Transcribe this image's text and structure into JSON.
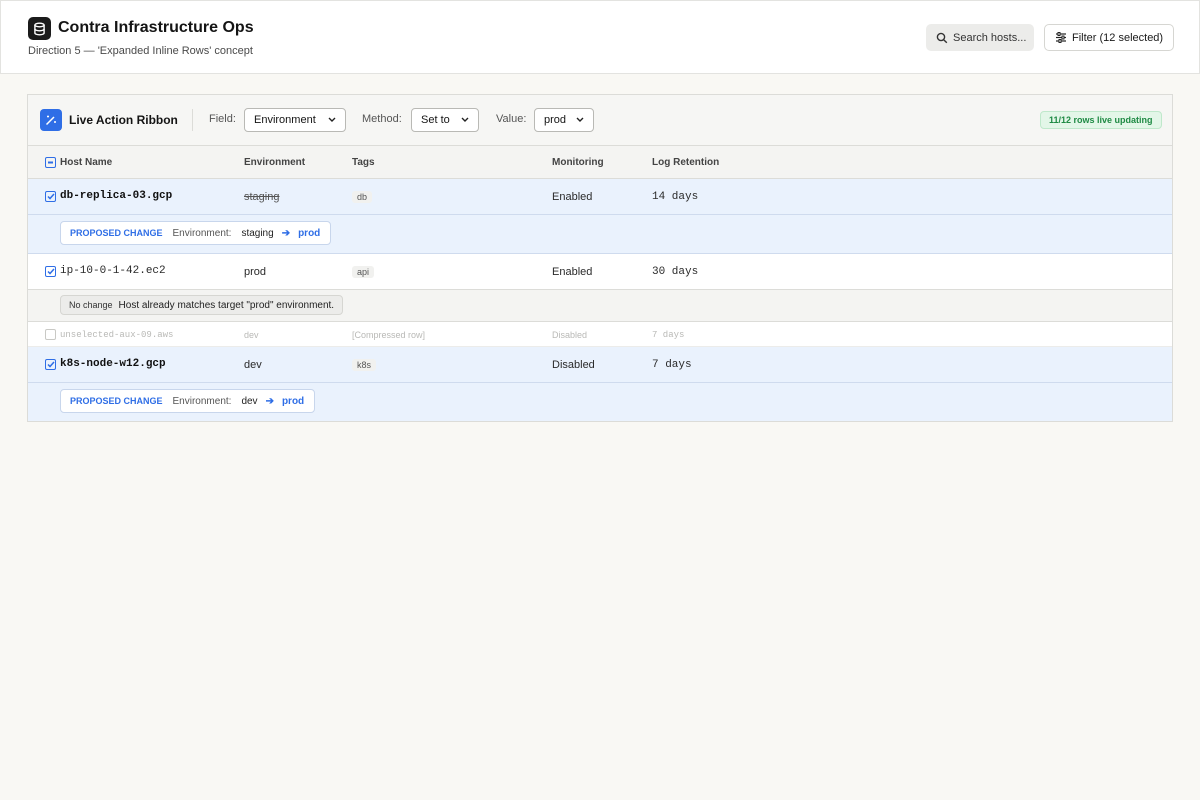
{
  "header": {
    "title": "Contra Infrastructure Ops",
    "subtitle": "Direction 5 — 'Expanded Inline Rows' concept",
    "search_placeholder": "Search hosts...",
    "filter_label": "Filter (12 selected)"
  },
  "ribbon": {
    "title": "Live Action Ribbon",
    "field_label": "Field:",
    "field_value": "Environment",
    "method_label": "Method:",
    "method_value": "Set to",
    "value_label": "Value:",
    "value_value": "prod",
    "live_status": "11/12 rows live updating"
  },
  "table": {
    "columns": [
      "Host Name",
      "Environment",
      "Tags",
      "Monitoring",
      "Log Retention"
    ],
    "rows": [
      {
        "host": "db-replica-03.gcp",
        "environment": "staging",
        "tag": "db",
        "monitoring": "Enabled",
        "retention": "14 days",
        "selected": true
      },
      {
        "host": "ip-10-0-1-42.ec2",
        "environment": "prod",
        "tag": "api",
        "monitoring": "Enabled",
        "retention": "30 days",
        "selected": true
      },
      {
        "host": "unselected-aux-09.aws",
        "environment": "dev",
        "tag": "[Compressed row]",
        "monitoring": "Disabled",
        "retention": "7 days",
        "selected": false
      },
      {
        "host": "k8s-node-w12.gcp",
        "environment": "dev",
        "tag": "k8s",
        "monitoring": "Disabled",
        "retention": "7 days",
        "selected": true
      }
    ],
    "changes": [
      {
        "title": "PROPOSED CHANGE",
        "field": "Environment:",
        "from": "staging",
        "to": "prod"
      },
      {
        "tag": "No change",
        "message": "Host already matches target \"prod\" environment."
      },
      {
        "title": "PROPOSED CHANGE",
        "field": "Environment:",
        "from": "dev",
        "to": "prod"
      }
    ]
  },
  "colors": {
    "accent": "#2f6ee6",
    "live": "#1f8a44",
    "selected_row": "#eaf2fd"
  }
}
